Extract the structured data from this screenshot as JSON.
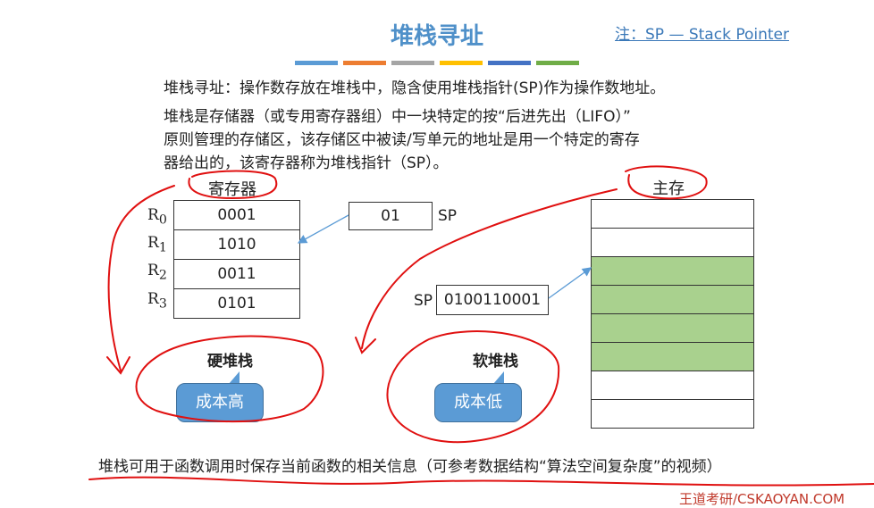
{
  "title": "堆栈寻址",
  "note": "注：SP — Stack Pointer",
  "color_bars": [
    "#5b9bd5",
    "#ed7d31",
    "#a5a5a5",
    "#ffc000",
    "#4472c4",
    "#70ad47"
  ],
  "paragraphs": {
    "p1": "堆栈寻址：操作数存放在堆栈中，隐含使用堆栈指针(SP)作为操作数地址。",
    "p2_line1": "堆栈是存储器（或专用寄存器组）中一块特定的按“后进先出（LIFO）”",
    "p2_line2": "原则管理的存储区，该存储区中被读/写单元的地址是用一个特定的寄存",
    "p2_line3": "器给出的，该寄存器称为堆栈指针（SP）。"
  },
  "registers": {
    "heading": "寄存器",
    "rows": [
      {
        "name": "R",
        "sub": "0",
        "value": "0001"
      },
      {
        "name": "R",
        "sub": "1",
        "value": "1010"
      },
      {
        "name": "R",
        "sub": "2",
        "value": "0011"
      },
      {
        "name": "R",
        "sub": "3",
        "value": "0101"
      }
    ],
    "sp_value": "01",
    "sp_label": "SP",
    "stack_label": "硬堆栈",
    "bubble": "成本高"
  },
  "memory": {
    "heading": "主存",
    "sp_label": "SP",
    "sp_value": "0100110001",
    "stack_label": "软堆栈",
    "bubble": "成本低",
    "cells_used": [
      false,
      false,
      true,
      true,
      true,
      true,
      false,
      false
    ]
  },
  "footer": "堆栈可用于函数调用时保存当前函数的相关信息（可参考数据结构“算法空间复杂度”的视频）",
  "watermark": "王道考研/CSKAOYAN.COM"
}
